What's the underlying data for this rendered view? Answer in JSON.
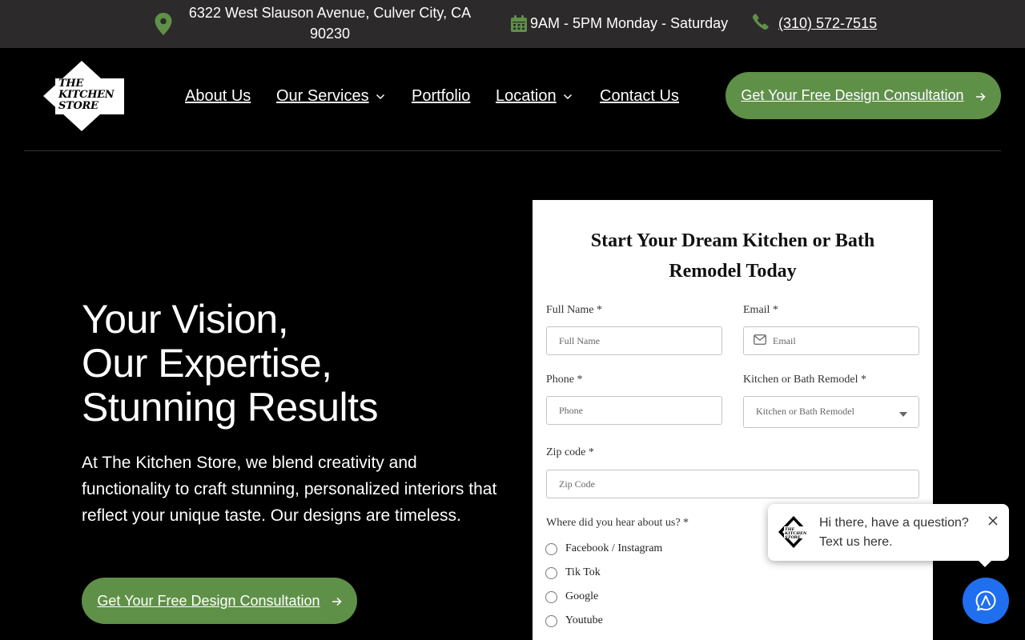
{
  "topbar": {
    "address_line1": "6322 West Slauson Avenue, Culver City, CA",
    "address_line2": "90230",
    "hours": "9AM - 5PM Monday - Saturday",
    "phone": "(310) 572-7515",
    "icons": [
      "map-pin-icon",
      "calendar-icon",
      "phone-icon"
    ],
    "icon_color": "#5f9048"
  },
  "logo": {
    "line1": "THE",
    "line2": "KITCHEN",
    "line3": "STORE"
  },
  "nav": {
    "items": [
      {
        "label": "About Us",
        "dropdown": false
      },
      {
        "label": "Our Services",
        "dropdown": true
      },
      {
        "label": "Portfolio",
        "dropdown": false
      },
      {
        "label": "Location",
        "dropdown": true
      },
      {
        "label": "Contact Us",
        "dropdown": false
      }
    ],
    "cta_label": "Get Your Free Design Consultation"
  },
  "hero": {
    "title_lines": [
      "Your Vision,",
      "Our Expertise,",
      "Stunning Results"
    ],
    "text": "At The Kitchen Store, we blend creativity and functionality to craft stunning, personalized interiors that reflect your unique taste. Our designs are timeless.",
    "cta_label": "Get Your Free Design Consultation"
  },
  "form": {
    "title": "Start Your Dream Kitchen or Bath Remodel Today",
    "full_name": {
      "label": "Full Name *",
      "placeholder": "Full Name"
    },
    "email": {
      "label": "Email *",
      "placeholder": "Email"
    },
    "phone": {
      "label": "Phone *",
      "placeholder": "Phone"
    },
    "remodel": {
      "label": "Kitchen or Bath Remodel *",
      "placeholder": "Kitchen or Bath Remodel"
    },
    "zip": {
      "label": "Zip code *",
      "placeholder": "Zip Code"
    },
    "source": {
      "label": "Where did you hear about us? *",
      "options": [
        "Facebook / Instagram",
        "Tik Tok",
        "Google",
        "Youtube"
      ]
    }
  },
  "chat": {
    "line1": "Hi there, have a question?",
    "line2": "Text us here.",
    "button_color": "#1f6ff0"
  },
  "colors": {
    "accent_green": "#5f9048",
    "topbar_bg": "#2c2a2b",
    "page_bg": "#000000"
  }
}
